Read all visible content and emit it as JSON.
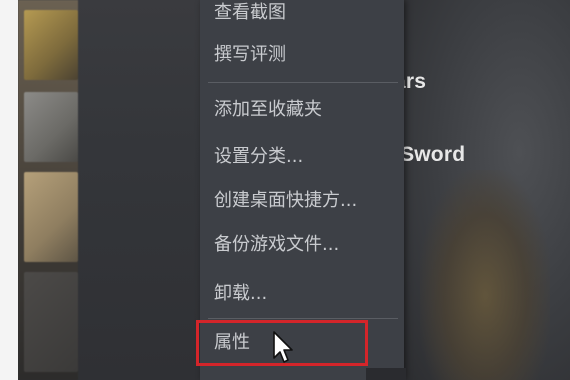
{
  "library": {
    "game_titles": [
      "/ars",
      "l Sword"
    ]
  },
  "context_menu": {
    "items": [
      "查看截图",
      "撰写评测",
      "添加至收藏夹",
      "设置分类...",
      "创建桌面快捷方...",
      "备份游戏文件...",
      "卸载...",
      "属性"
    ]
  },
  "colors": {
    "menu_bg": "#3d4046",
    "menu_text": "#c9cbcf",
    "highlight_box": "#d4252a"
  },
  "icons": {
    "cursor": "arrow-cursor-icon"
  }
}
